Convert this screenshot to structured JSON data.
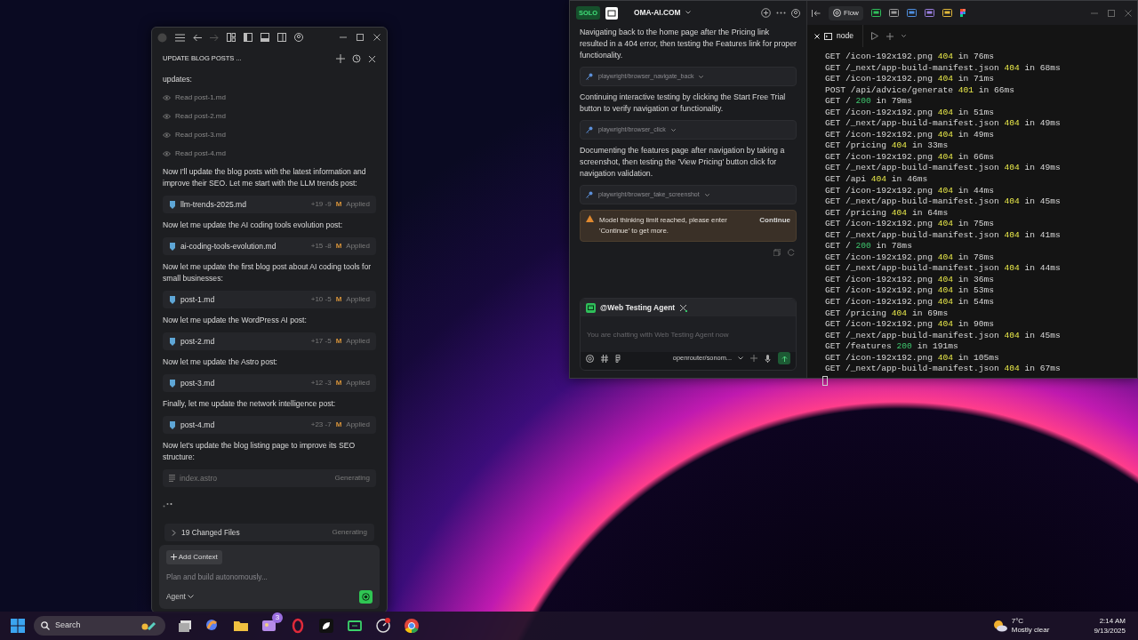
{
  "editor_window": {
    "title": "UPDATE BLOG POSTS ...",
    "feed": [
      {
        "kind": "text",
        "text": "updates:"
      },
      {
        "kind": "read",
        "text": "Read post-1.md"
      },
      {
        "kind": "read",
        "text": "Read post-2.md"
      },
      {
        "kind": "read",
        "text": "Read post-3.md"
      },
      {
        "kind": "read",
        "text": "Read post-4.md"
      },
      {
        "kind": "text",
        "text": "Now I'll update the blog posts with the latest information and improve their SEO. Let me start with the LLM trends post:"
      },
      {
        "kind": "file",
        "name": "llm-trends-2025.md",
        "added": "+19",
        "removed": "-9",
        "flag": "M",
        "status": "Applied"
      },
      {
        "kind": "text",
        "text": "Now let me update the AI coding tools evolution post:"
      },
      {
        "kind": "file",
        "name": "ai-coding-tools-evolution.md",
        "added": "+15",
        "removed": "-8",
        "flag": "M",
        "status": "Applied"
      },
      {
        "kind": "text",
        "text": "Now let me update the first blog post about AI coding tools for small businesses:"
      },
      {
        "kind": "file",
        "name": "post-1.md",
        "added": "+10",
        "removed": "-5",
        "flag": "M",
        "status": "Applied"
      },
      {
        "kind": "text",
        "text": "Now let me update the WordPress AI post:"
      },
      {
        "kind": "file",
        "name": "post-2.md",
        "added": "+17",
        "removed": "-5",
        "flag": "M",
        "status": "Applied"
      },
      {
        "kind": "text",
        "text": "Now let me update the Astro post:"
      },
      {
        "kind": "file",
        "name": "post-3.md",
        "added": "+12",
        "removed": "-3",
        "flag": "M",
        "status": "Applied"
      },
      {
        "kind": "text",
        "text": "Finally, let me update the network intelligence post:"
      },
      {
        "kind": "file",
        "name": "post-4.md",
        "added": "+23",
        "removed": "-7",
        "flag": "M",
        "status": "Applied"
      },
      {
        "kind": "text",
        "text": "Now let's update the blog listing page to improve its SEO structure:"
      },
      {
        "kind": "pending",
        "name": "index.astro",
        "status": "Generating"
      },
      {
        "kind": "loader"
      }
    ],
    "changed_files": {
      "label": "19 Changed Files",
      "status": "Generating"
    },
    "composer": {
      "add_context": "Add Context",
      "placeholder": "Plan and build autonomously...",
      "mode": "Agent"
    }
  },
  "chat_panel": {
    "badge": "SOLO",
    "project": "OMA-AI.COM",
    "messages": [
      {
        "text": "Navigating back to the home page after the Pricing link resulted in a 404 error, then testing the Features link for proper functionality.",
        "tool": "playwright/browser_navigate_back"
      },
      {
        "text": "Continuing interactive testing by clicking the Start Free Trial button to verify navigation or functionality.",
        "tool": "playwright/browser_click"
      },
      {
        "text": "Documenting the features page after navigation by taking a screenshot, then testing the 'View Pricing' button click for navigation validation.",
        "tool": "playwright/browser_take_screenshot"
      }
    ],
    "warning": {
      "text": "Model thinking limit reached, please enter 'Continue' to get more.",
      "action": "Continue"
    },
    "agent": {
      "name": "@Web Testing Agent",
      "placeholder": "You are chatting with Web Testing Agent now",
      "model": "openrouter/sonom..."
    }
  },
  "toolbar": {
    "flow": "Flow"
  },
  "terminal": {
    "tab": "node",
    "lines": [
      {
        "request": "GET /icon-192x192.png",
        "status": "404",
        "timing": "in 76ms",
        "kind": "error"
      },
      {
        "request": "GET /_next/app-build-manifest.json",
        "status": "404",
        "timing": "in 68ms",
        "kind": "error"
      },
      {
        "request": "GET /icon-192x192.png",
        "status": "404",
        "timing": "in 71ms",
        "kind": "error"
      },
      {
        "request": "POST /api/advice/generate",
        "status": "401",
        "timing": "in 66ms",
        "kind": "error"
      },
      {
        "request": "GET /",
        "status": "200",
        "timing": "in 79ms",
        "kind": "ok"
      },
      {
        "request": "GET /icon-192x192.png",
        "status": "404",
        "timing": "in 51ms",
        "kind": "error"
      },
      {
        "request": "GET /_next/app-build-manifest.json",
        "status": "404",
        "timing": "in 49ms",
        "kind": "error"
      },
      {
        "request": "GET /icon-192x192.png",
        "status": "404",
        "timing": "in 49ms",
        "kind": "error"
      },
      {
        "request": "GET /pricing",
        "status": "404",
        "timing": "in 33ms",
        "kind": "error"
      },
      {
        "request": "GET /icon-192x192.png",
        "status": "404",
        "timing": "in 66ms",
        "kind": "error"
      },
      {
        "request": "GET /_next/app-build-manifest.json",
        "status": "404",
        "timing": "in 49ms",
        "kind": "error"
      },
      {
        "request": "GET /api",
        "status": "404",
        "timing": "in 46ms",
        "kind": "error"
      },
      {
        "request": "GET /icon-192x192.png",
        "status": "404",
        "timing": "in 44ms",
        "kind": "error"
      },
      {
        "request": "GET /_next/app-build-manifest.json",
        "status": "404",
        "timing": "in 45ms",
        "kind": "error"
      },
      {
        "request": "GET /pricing",
        "status": "404",
        "timing": "in 64ms",
        "kind": "error"
      },
      {
        "request": "GET /icon-192x192.png",
        "status": "404",
        "timing": "in 75ms",
        "kind": "error"
      },
      {
        "request": "GET /_next/app-build-manifest.json",
        "status": "404",
        "timing": "in 41ms",
        "kind": "error"
      },
      {
        "request": "GET /",
        "status": "200",
        "timing": "in 78ms",
        "kind": "ok"
      },
      {
        "request": "GET /icon-192x192.png",
        "status": "404",
        "timing": "in 78ms",
        "kind": "error"
      },
      {
        "request": "GET /_next/app-build-manifest.json",
        "status": "404",
        "timing": "in 44ms",
        "kind": "error"
      },
      {
        "request": "GET /icon-192x192.png",
        "status": "404",
        "timing": "in 36ms",
        "kind": "error"
      },
      {
        "request": "GET /icon-192x192.png",
        "status": "404",
        "timing": "in 53ms",
        "kind": "error"
      },
      {
        "request": "GET /icon-192x192.png",
        "status": "404",
        "timing": "in 54ms",
        "kind": "error"
      },
      {
        "request": "GET /pricing",
        "status": "404",
        "timing": "in 69ms",
        "kind": "error"
      },
      {
        "request": "GET /icon-192x192.png",
        "status": "404",
        "timing": "in 90ms",
        "kind": "error"
      },
      {
        "request": "GET /_next/app-build-manifest.json",
        "status": "404",
        "timing": "in 45ms",
        "kind": "error"
      },
      {
        "request": "GET /features",
        "status": "200",
        "timing": "in 191ms",
        "kind": "ok"
      },
      {
        "request": "GET /icon-192x192.png",
        "status": "404",
        "timing": "in 105ms",
        "kind": "error"
      },
      {
        "request": "GET /_next/app-build-manifest.json",
        "status": "404",
        "timing": "in 67ms",
        "kind": "error"
      }
    ]
  },
  "taskbar": {
    "search": {
      "placeholder": "Search"
    },
    "notification_count": "3",
    "weather": {
      "temperature": "7°C",
      "condition": "Mostly clear"
    },
    "time": "2:14 AM",
    "date": "9/13/2025"
  }
}
